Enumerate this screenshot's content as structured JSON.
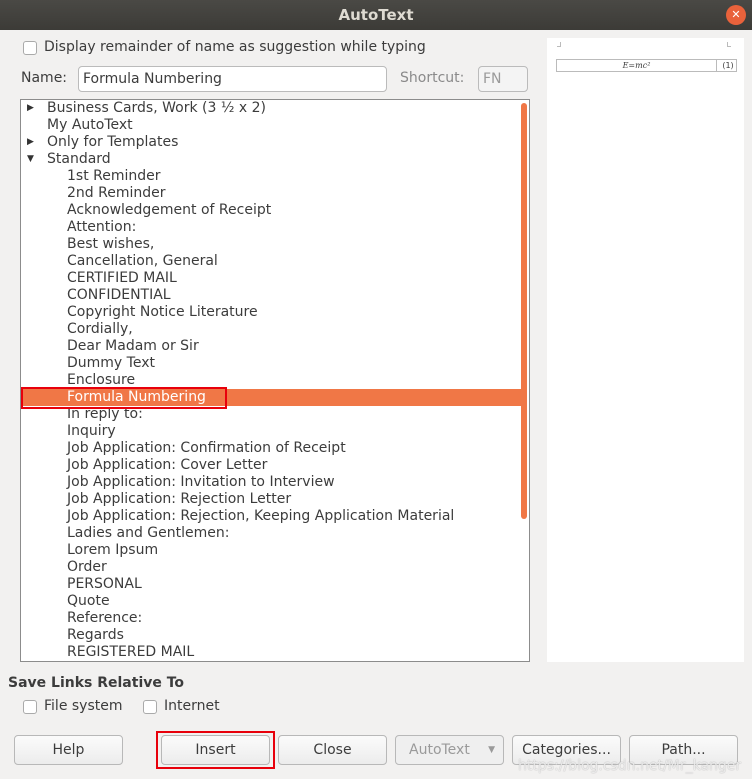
{
  "window": {
    "title": "AutoText",
    "close_icon": "close-icon"
  },
  "options": {
    "display_remainder_label": "Display remainder of name as suggestion while typing",
    "display_remainder_checked": false
  },
  "name_field": {
    "label": "Name:",
    "value": "Formula Numbering"
  },
  "shortcut_field": {
    "label": "Shortcut:",
    "value": "FN"
  },
  "tree": {
    "items": [
      {
        "label": "Business Cards, Work (3 ½ x 2)",
        "level": 0,
        "expander": "collapsed"
      },
      {
        "label": "My AutoText",
        "level": 0,
        "expander": "none"
      },
      {
        "label": "Only for Templates",
        "level": 0,
        "expander": "collapsed"
      },
      {
        "label": "Standard",
        "level": 0,
        "expander": "expanded"
      },
      {
        "label": "1st Reminder",
        "level": 1
      },
      {
        "label": "2nd Reminder",
        "level": 1
      },
      {
        "label": "Acknowledgement of Receipt",
        "level": 1
      },
      {
        "label": "Attention:",
        "level": 1
      },
      {
        "label": "Best wishes,",
        "level": 1
      },
      {
        "label": "Cancellation, General",
        "level": 1
      },
      {
        "label": "CERTIFIED MAIL",
        "level": 1
      },
      {
        "label": "CONFIDENTIAL",
        "level": 1
      },
      {
        "label": "Copyright Notice Literature",
        "level": 1
      },
      {
        "label": "Cordially,",
        "level": 1
      },
      {
        "label": "Dear Madam or Sir",
        "level": 1
      },
      {
        "label": "Dummy Text",
        "level": 1
      },
      {
        "label": "Enclosure",
        "level": 1
      },
      {
        "label": "Formula Numbering",
        "level": 1,
        "selected": true
      },
      {
        "label": "In reply to:",
        "level": 1
      },
      {
        "label": "Inquiry",
        "level": 1
      },
      {
        "label": "Job Application: Confirmation of Receipt",
        "level": 1
      },
      {
        "label": "Job Application: Cover Letter",
        "level": 1
      },
      {
        "label": "Job Application: Invitation to Interview",
        "level": 1
      },
      {
        "label": "Job Application: Rejection Letter",
        "level": 1
      },
      {
        "label": "Job Application: Rejection, Keeping Application Material",
        "level": 1
      },
      {
        "label": "Ladies and Gentlemen:",
        "level": 1
      },
      {
        "label": "Lorem Ipsum",
        "level": 1
      },
      {
        "label": "Order",
        "level": 1
      },
      {
        "label": "PERSONAL",
        "level": 1
      },
      {
        "label": "Quote",
        "level": 1
      },
      {
        "label": "Reference:",
        "level": 1
      },
      {
        "label": "Regards",
        "level": 1
      },
      {
        "label": "REGISTERED MAIL",
        "level": 1
      }
    ]
  },
  "preview": {
    "formula": "E=mc²",
    "number": "(1)"
  },
  "save_links": {
    "heading": "Save Links Relative To",
    "file_system": "File system",
    "file_system_checked": false,
    "internet": "Internet",
    "internet_checked": false
  },
  "buttons": {
    "help": "Help",
    "insert": "Insert",
    "close": "Close",
    "autotext": "AutoText",
    "categories": "Categories...",
    "path": "Path..."
  },
  "watermark": "https://blog.csdn.net/Mr_kanger",
  "colors": {
    "accent": "#f07746",
    "highlight_box": "#e8000b"
  }
}
